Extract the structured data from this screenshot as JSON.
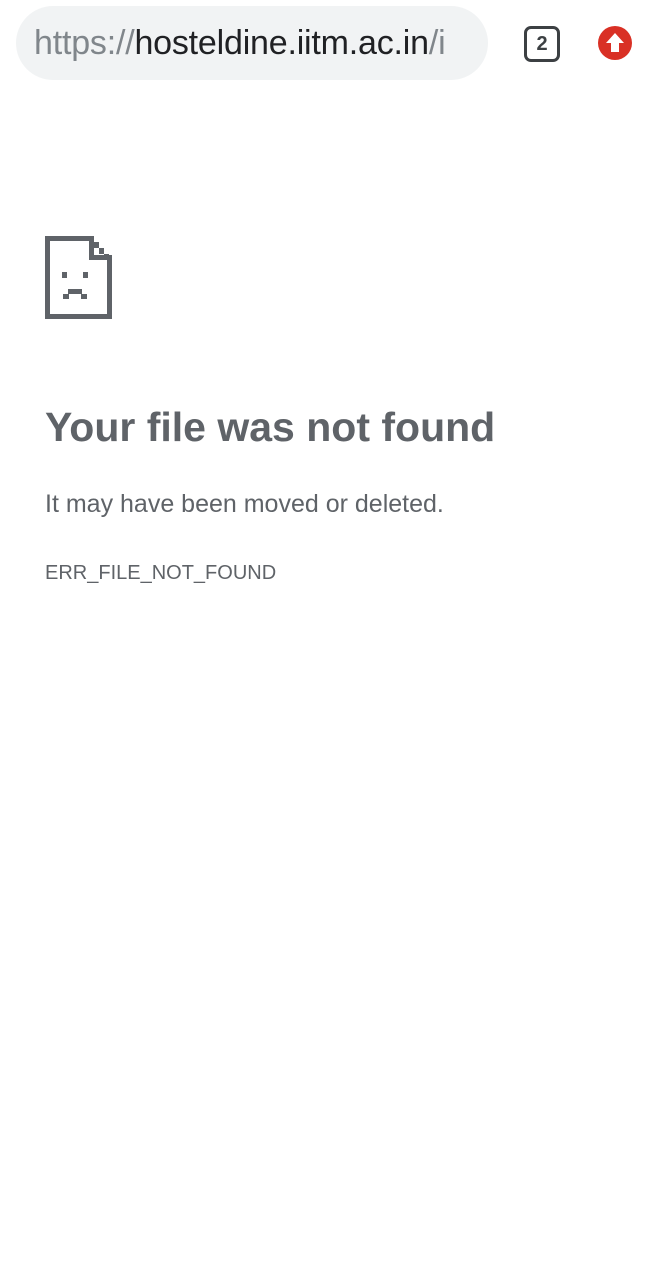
{
  "toolbar": {
    "url_scheme": "https://",
    "url_host": "hosteldine.iitm.ac.in",
    "url_path": "/i",
    "tab_count": "2",
    "update_icon": "arrow-up-circle-icon",
    "update_color": "#d93025"
  },
  "error": {
    "icon": "sad-document-icon",
    "title": "Your file was not found",
    "description": "It may have been moved or deleted.",
    "code": "ERR_FILE_NOT_FOUND"
  },
  "colors": {
    "text": "#5f6368",
    "omnibox_bg": "#f1f3f4"
  }
}
